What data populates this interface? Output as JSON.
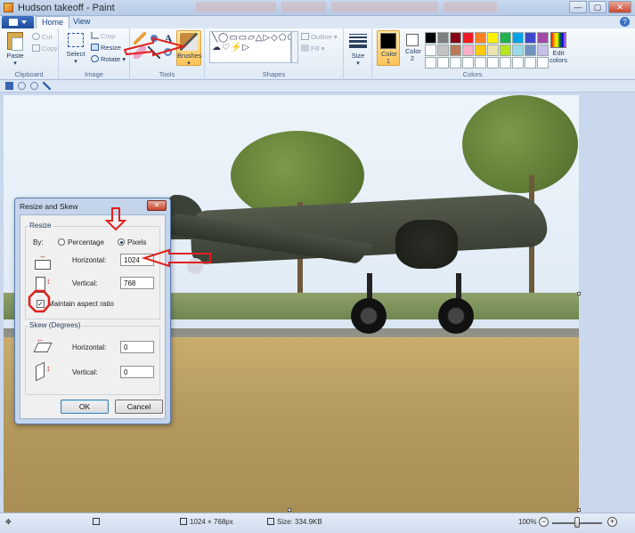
{
  "window": {
    "title": "Hudson takeoff - Paint",
    "min": "—",
    "max": "▢",
    "close": "✕"
  },
  "tabs": {
    "home": "Home",
    "view": "View"
  },
  "ribbon": {
    "clipboard": {
      "label": "Clipboard",
      "paste": "Paste",
      "cut": "Cut",
      "copy": "Copy"
    },
    "image": {
      "label": "Image",
      "select": "Select",
      "crop": "Crop",
      "resize": "Resize",
      "rotate": "Rotate"
    },
    "tools": {
      "label": "Tools",
      "brushes": "Brushes"
    },
    "shapes": {
      "label": "Shapes",
      "glyphs": "╲◯▭▭▱△▷◇⬠⬡→←↑↓✦★✶☐☁♡⚡▷",
      "outline": "Outline",
      "fill": "Fill"
    },
    "size": {
      "label": "Size"
    },
    "colors": {
      "label": "Colors",
      "color1": "Color 1",
      "color2": "Color 2",
      "edit": "Edit colors",
      "color1_value": "#000000",
      "color2_value": "#ffffff",
      "palette": [
        "#000000",
        "#7f7f7f",
        "#880015",
        "#ed1c24",
        "#ff7f27",
        "#fff200",
        "#22b14c",
        "#00a2e8",
        "#3f48cc",
        "#a349a4",
        "#ffffff",
        "#c3c3c3",
        "#b97a57",
        "#ffaec9",
        "#ffc90e",
        "#efe4b0",
        "#b5e61d",
        "#99d9ea",
        "#7092be",
        "#c8bfe7",
        "#ffffff",
        "#ffffff",
        "#ffffff",
        "#ffffff",
        "#ffffff",
        "#ffffff",
        "#ffffff",
        "#ffffff",
        "#ffffff",
        "#ffffff"
      ]
    }
  },
  "status": {
    "dimensions": "1024 × 768px",
    "size": "Size: 334.9KB",
    "zoom": "100%",
    "zoom_fraction": 0.5
  },
  "dialog": {
    "title": "Resize and Skew",
    "resize_legend": "Resize",
    "by": "By:",
    "percentage": "Percentage",
    "pixels": "Pixels",
    "selected_unit": "pixels",
    "horizontal": "Horizontal:",
    "vertical": "Vertical:",
    "horizontal_value": "1024",
    "vertical_value": "768",
    "maintain": "Maintain aspect ratio",
    "maintain_checked": true,
    "skew_legend": "Skew (Degrees)",
    "skew_horizontal_value": "0",
    "skew_vertical_value": "0",
    "ok": "OK",
    "cancel": "Cancel"
  },
  "accent": {
    "annotation_red": "#e0201c",
    "ribbon_blue": "#1e395b"
  }
}
